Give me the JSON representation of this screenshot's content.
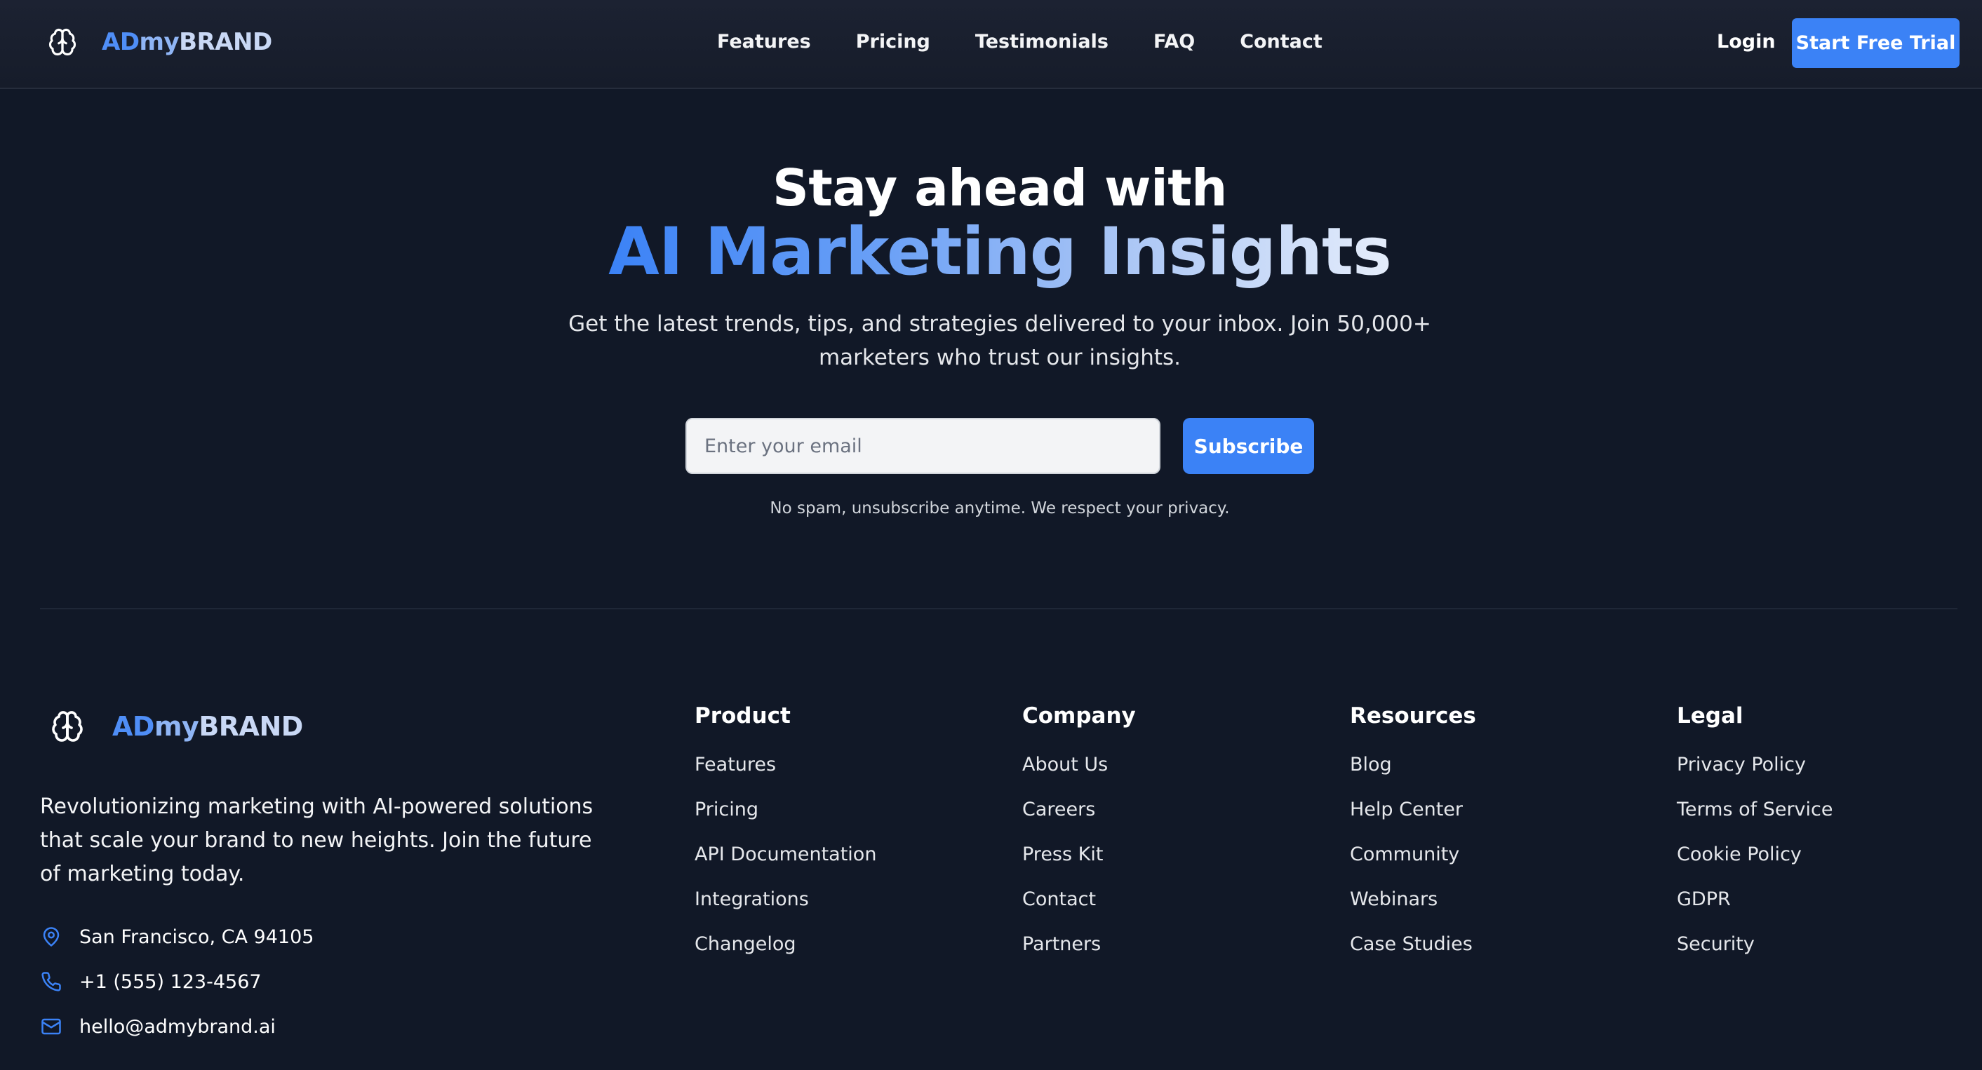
{
  "nav": {
    "brand": {
      "ad": "AD",
      "my": "my",
      "rest": "BRAND",
      "icon": "brain-icon"
    },
    "links": [
      "Features",
      "Pricing",
      "Testimonials",
      "FAQ",
      "Contact"
    ],
    "login": "Login",
    "cta": "Start Free Trial"
  },
  "hero": {
    "title_line1": "Stay ahead with",
    "title_line2": "AI Marketing Insights",
    "subtitle": "Get the latest trends, tips, and strategies delivered to your inbox. Join 50,000+ marketers who trust our insights.",
    "email_placeholder": "Enter your email",
    "email_value": "",
    "subscribe": "Subscribe",
    "privacy_note": "No spam, unsubscribe anytime. We respect your privacy."
  },
  "footer": {
    "brand": {
      "ad": "AD",
      "my": "my",
      "rest": "BRAND",
      "icon": "brain-icon"
    },
    "about": "Revolutionizing marketing with AI-powered solutions that scale your brand to new heights. Join the future of marketing today.",
    "contact": {
      "address": "San Francisco, CA 94105",
      "phone": "+1 (555) 123-4567",
      "email": "hello@admybrand.ai"
    },
    "columns": [
      {
        "title": "Product",
        "links": [
          "Features",
          "Pricing",
          "API Documentation",
          "Integrations",
          "Changelog"
        ]
      },
      {
        "title": "Company",
        "links": [
          "About Us",
          "Careers",
          "Press Kit",
          "Contact",
          "Partners"
        ]
      },
      {
        "title": "Resources",
        "links": [
          "Blog",
          "Help Center",
          "Community",
          "Webinars",
          "Case Studies"
        ]
      },
      {
        "title": "Legal",
        "links": [
          "Privacy Policy",
          "Terms of Service",
          "Cookie Policy",
          "GDPR",
          "Security"
        ]
      }
    ]
  },
  "colors": {
    "background": "#111827",
    "accent": "#3b82f6",
    "brand_gradient_start": "#4f8ef7",
    "brand_gradient_end": "#c9d8f5"
  }
}
